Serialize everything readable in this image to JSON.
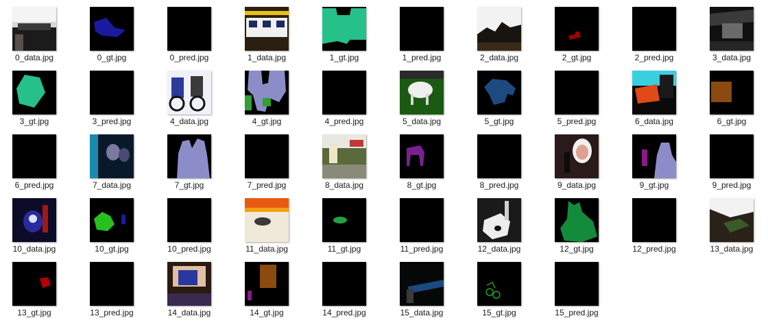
{
  "files": [
    {
      "name": "0_data.jpg",
      "kind": "data"
    },
    {
      "name": "0_gt.jpg",
      "kind": "gt"
    },
    {
      "name": "0_pred.jpg",
      "kind": "pred"
    },
    {
      "name": "1_data.jpg",
      "kind": "data"
    },
    {
      "name": "1_gt.jpg",
      "kind": "gt"
    },
    {
      "name": "1_pred.jpg",
      "kind": "pred"
    },
    {
      "name": "2_data.jpg",
      "kind": "data"
    },
    {
      "name": "2_gt.jpg",
      "kind": "gt"
    },
    {
      "name": "2_pred.jpg",
      "kind": "pred"
    },
    {
      "name": "3_data.jpg",
      "kind": "data"
    },
    {
      "name": "3_gt.jpg",
      "kind": "gt"
    },
    {
      "name": "3_pred.jpg",
      "kind": "pred"
    },
    {
      "name": "4_data.jpg",
      "kind": "data"
    },
    {
      "name": "4_gt.jpg",
      "kind": "gt"
    },
    {
      "name": "4_pred.jpg",
      "kind": "pred"
    },
    {
      "name": "5_data.jpg",
      "kind": "data"
    },
    {
      "name": "5_gt.jpg",
      "kind": "gt"
    },
    {
      "name": "5_pred.jpg",
      "kind": "pred"
    },
    {
      "name": "6_data.jpg",
      "kind": "data"
    },
    {
      "name": "6_gt.jpg",
      "kind": "gt"
    },
    {
      "name": "6_pred.jpg",
      "kind": "pred"
    },
    {
      "name": "7_data.jpg",
      "kind": "data"
    },
    {
      "name": "7_gt.jpg",
      "kind": "gt"
    },
    {
      "name": "7_pred.jpg",
      "kind": "pred"
    },
    {
      "name": "8_data.jpg",
      "kind": "data"
    },
    {
      "name": "8_gt.jpg",
      "kind": "gt"
    },
    {
      "name": "8_pred.jpg",
      "kind": "pred"
    },
    {
      "name": "9_data.jpg",
      "kind": "data"
    },
    {
      "name": "9_gt.jpg",
      "kind": "gt"
    },
    {
      "name": "9_pred.jpg",
      "kind": "pred"
    },
    {
      "name": "10_data.jpg",
      "kind": "data"
    },
    {
      "name": "10_gt.jpg",
      "kind": "gt"
    },
    {
      "name": "10_pred.jpg",
      "kind": "pred"
    },
    {
      "name": "11_data.jpg",
      "kind": "data"
    },
    {
      "name": "11_gt.jpg",
      "kind": "gt"
    },
    {
      "name": "11_pred.jpg",
      "kind": "pred"
    },
    {
      "name": "12_data.jpg",
      "kind": "data"
    },
    {
      "name": "12_gt.jpg",
      "kind": "gt"
    },
    {
      "name": "12_pred.jpg",
      "kind": "pred"
    },
    {
      "name": "13_data.jpg",
      "kind": "data"
    },
    {
      "name": "13_gt.jpg",
      "kind": "gt"
    },
    {
      "name": "13_pred.jpg",
      "kind": "pred"
    },
    {
      "name": "14_data.jpg",
      "kind": "data"
    },
    {
      "name": "14_gt.jpg",
      "kind": "gt"
    },
    {
      "name": "14_pred.jpg",
      "kind": "pred"
    },
    {
      "name": "15_data.jpg",
      "kind": "data"
    },
    {
      "name": "15_gt.jpg",
      "kind": "gt"
    },
    {
      "name": "15_pred.jpg",
      "kind": "pred"
    }
  ]
}
